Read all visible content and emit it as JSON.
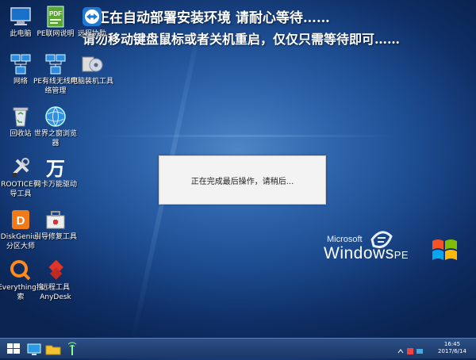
{
  "banner": {
    "line1": "统正在自动部署安装环境  请耐心等待……",
    "line2": "请勿移动键盘鼠标或者关机重启，仅仅只需等待即可……"
  },
  "icons": {
    "my_computer": "此电脑",
    "pe_network": "PE联网说明",
    "teamviewer": "远程协助",
    "network": "网络",
    "pe_net_manager_1": "PE有线无线网",
    "pe_net_manager_2": "络管理",
    "pc_repair": "电脑装机工具",
    "recycle_bin": "回收站",
    "browser_1": "世界之窗浏览",
    "browser_2": "器",
    "rootice_1": "ROOTICE引",
    "rootice_2": "导工具",
    "wanjia_driver": "网卡万能驱动",
    "diskgenius_1": "DiskGenius",
    "diskgenius_2": "分区大师",
    "boot_repair": "引导修复工具",
    "everything_1": "Everything搜",
    "everything_2": "索",
    "anydesk_1": "远程工具",
    "anydesk_2": "AnyDesk"
  },
  "dialog": {
    "message": "正在完成最后操作，请稍后..."
  },
  "brand": {
    "microsoft": "Microsoft",
    "windows": "Windows",
    "pe": "PE"
  },
  "taskbar": {
    "time": "16:45",
    "date": "2017/6/14"
  },
  "colors": {
    "accent": "#2f66ad",
    "taskbar": "#1b3866"
  }
}
